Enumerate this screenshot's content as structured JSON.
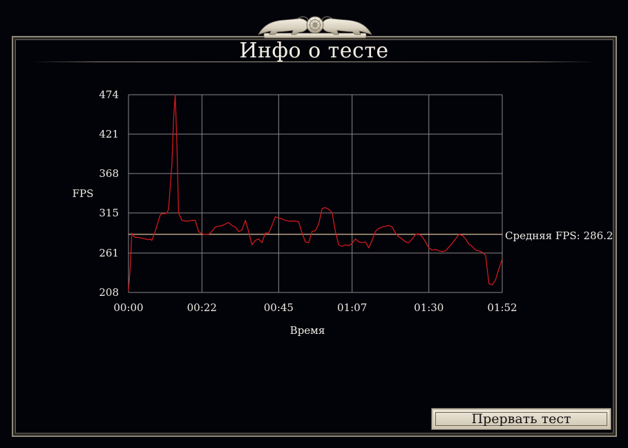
{
  "window": {
    "title": "Инфо о тесте"
  },
  "actions": {
    "abort_label": "Прервать тест"
  },
  "colors": {
    "background": "#03030a",
    "series": "#d21a1a",
    "average_line": "#f2d9b0",
    "grid": "#8a8a8a",
    "text": "#f0ede6"
  },
  "icons": {
    "emblem": "lion-crest-emblem-icon"
  },
  "chart_data": {
    "type": "line",
    "title": "",
    "xlabel": "Время",
    "ylabel": "FPS",
    "x_tick_labels": [
      "00:00",
      "00:22",
      "00:45",
      "01:07",
      "01:30",
      "01:52"
    ],
    "x_tick_seconds": [
      0,
      22,
      45,
      67,
      90,
      112
    ],
    "y_ticks": [
      208,
      261,
      315,
      368,
      421,
      474
    ],
    "ylim": [
      208,
      474
    ],
    "xlim_seconds": [
      0,
      112
    ],
    "grid": true,
    "average": {
      "label": "Средняя FPS: 286.2",
      "value": 286.2
    },
    "series": [
      {
        "x": [
          0,
          0.5,
          1,
          1.5,
          2,
          3,
          4,
          5,
          6,
          6.5,
          7,
          8,
          9,
          9.5,
          10,
          11,
          11.5,
          12,
          13,
          13.5,
          14,
          14.5,
          15,
          16,
          17,
          18,
          19,
          20,
          21,
          22,
          23,
          24,
          25,
          26,
          27,
          28,
          29,
          30,
          31,
          32,
          33,
          34,
          35,
          36,
          37,
          38,
          39,
          40,
          41,
          42,
          43,
          44,
          45,
          46,
          47,
          48,
          49,
          50,
          51,
          52,
          53,
          54,
          55,
          56,
          57,
          58,
          59,
          60,
          61,
          62,
          63,
          64,
          65,
          66,
          67,
          68,
          69,
          70,
          71,
          72,
          73,
          74,
          75,
          76,
          77,
          78,
          79,
          80,
          81,
          82,
          83,
          84,
          85,
          86,
          87,
          88,
          89,
          90,
          91,
          92,
          93,
          94,
          95,
          96,
          97,
          98,
          99,
          100,
          101,
          102,
          103,
          104,
          105,
          106,
          107,
          108,
          109,
          110,
          111,
          112
        ],
        "y": [
          210,
          240,
          288,
          284,
          282,
          282,
          281,
          280,
          279,
          280,
          278,
          290,
          305,
          312,
          314,
          314,
          315,
          320,
          380,
          440,
          474,
          410,
          315,
          305,
          304,
          304,
          305,
          305,
          290,
          287,
          286,
          286,
          290,
          296,
          297,
          298,
          300,
          302,
          298,
          296,
          290,
          292,
          305,
          290,
          272,
          278,
          280,
          275,
          288,
          288,
          298,
          310,
          308,
          307,
          305,
          304,
          304,
          304,
          303,
          288,
          276,
          275,
          290,
          291,
          300,
          321,
          322,
          320,
          315,
          290,
          272,
          270,
          272,
          271,
          274,
          280,
          276,
          275,
          276,
          268,
          278,
          290,
          294,
          296,
          297,
          298,
          296,
          288,
          283,
          280,
          276,
          275,
          280,
          286,
          287,
          283,
          276,
          268,
          265,
          266,
          264,
          263,
          264,
          269,
          274,
          280,
          286,
          285,
          280,
          273,
          270,
          265,
          264,
          262,
          258,
          220,
          218,
          225,
          240,
          253
        ]
      }
    ]
  }
}
